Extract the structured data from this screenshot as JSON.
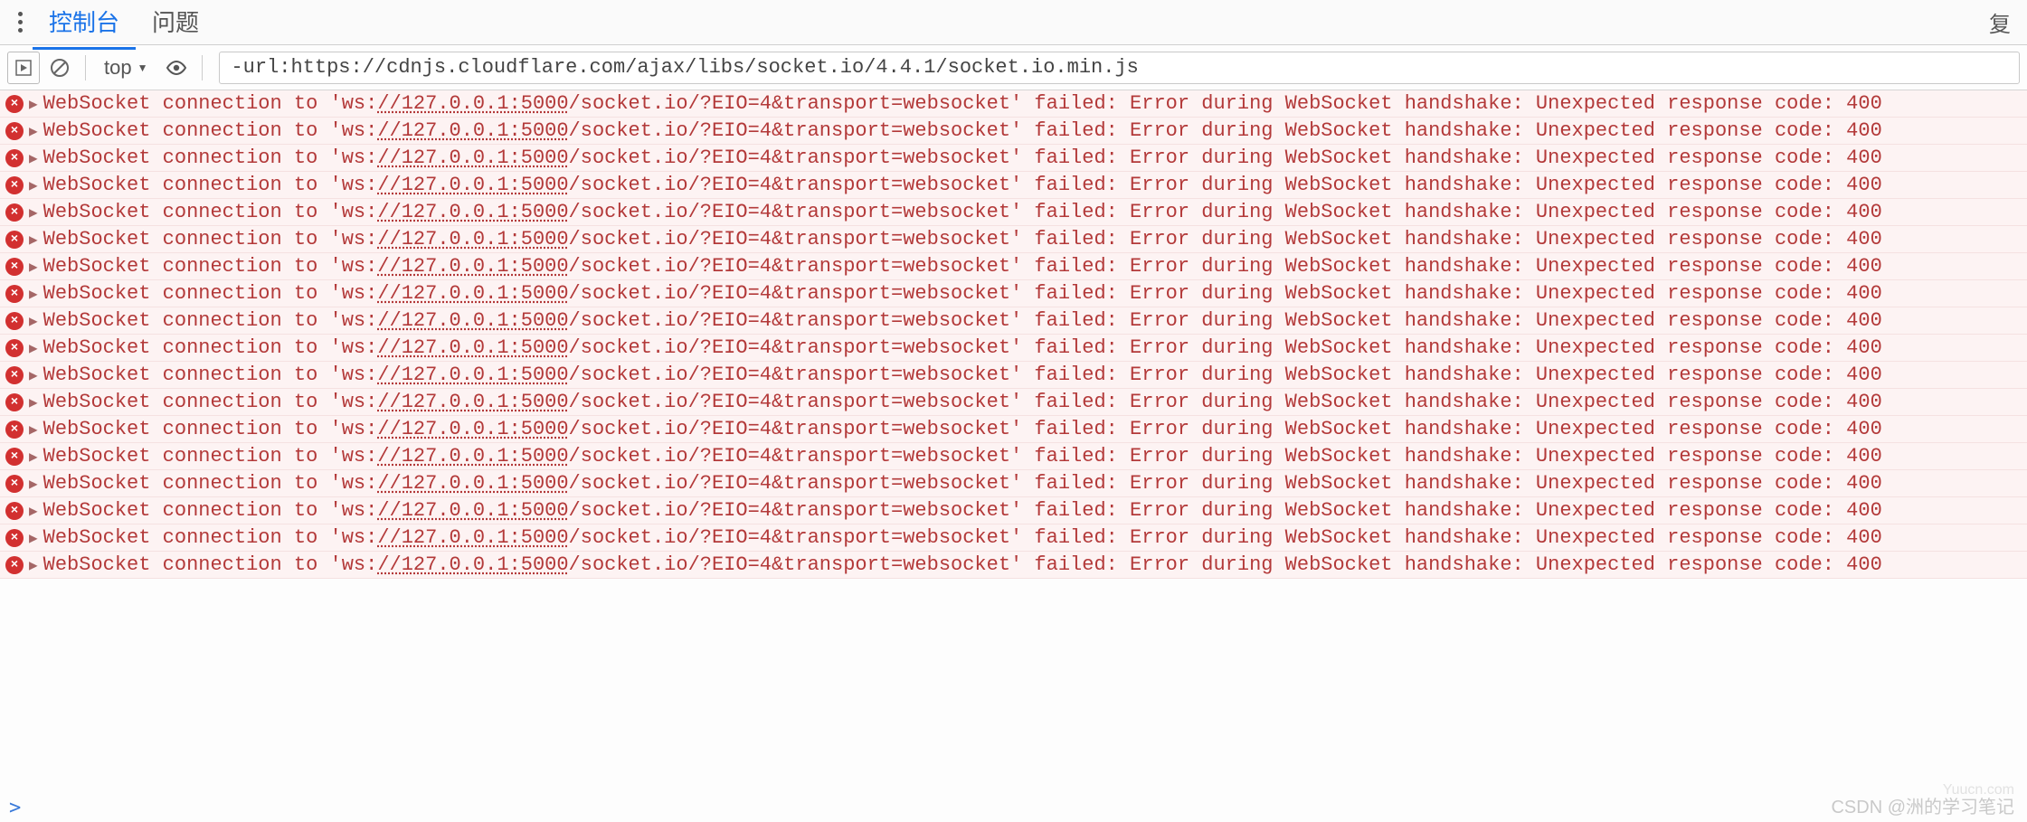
{
  "tabs": {
    "console": "控制台",
    "issues": "问题"
  },
  "top_right_button": "复",
  "toolbar": {
    "context_label": "top",
    "filter_value": "-url:https://cdnjs.cloudflare.com/ajax/libs/socket.io/4.4.1/socket.io.min.js"
  },
  "log_entry": {
    "prefix": "WebSocket connection to '",
    "scheme": "ws:",
    "url": "//127.0.0.1:5000",
    "path": "/socket.io/?EIO=4&transport=websocket",
    "suffix": "' failed: Error during WebSocket handshake: Unexpected response code: 400"
  },
  "log_count": 18,
  "prompt": ">",
  "watermark": {
    "site": "Yuucn.com",
    "text": "CSDN @洲的学习笔记"
  }
}
